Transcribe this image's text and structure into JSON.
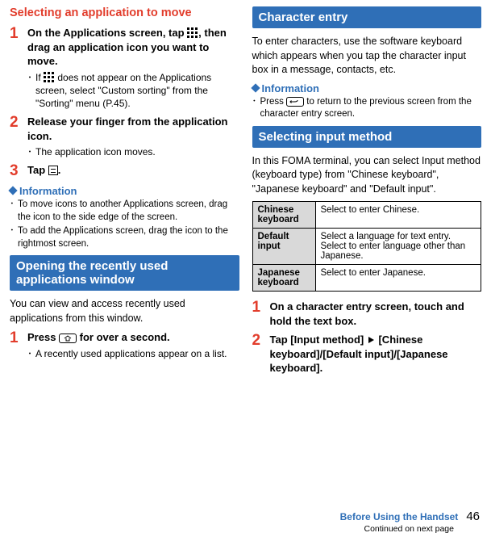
{
  "left": {
    "title": "Selecting an application to move",
    "step1": {
      "head_a": "On the Applications screen, tap ",
      "head_b": ", then drag an application icon you want to move.",
      "bullet1_a": "If ",
      "bullet1_b": " does not appear on the Applications screen, select \"Custom sorting\" from the \"Sorting\" menu (P.45)."
    },
    "step2": {
      "head": "Release your finger from the application icon.",
      "bullet1": "The application icon moves."
    },
    "step3": {
      "head_a": "Tap ",
      "head_b": "."
    },
    "info_title": "Information",
    "info1": "To move icons to another Applications screen, drag the icon to the side edge of the screen.",
    "info2": "To add the Applications screen, drag the icon to the rightmost screen.",
    "heading2": "Opening the recently used applications window",
    "para2": "You can view and access recently used applications from this window.",
    "step_b1": {
      "head_a": "Press ",
      "head_b": " for over a second.",
      "bullet1": "A recently used applications appear on a list."
    }
  },
  "right": {
    "heading1": "Character entry",
    "para1": "To enter characters, use the software keyboard which appears when you tap the character input box in a message, contacts, etc.",
    "info_title": "Information",
    "info1_a": "Press ",
    "info1_b": " to return to the previous screen from the character entry screen.",
    "heading2": "Selecting input method",
    "para2": "In this FOMA terminal, you can select Input method (keyboard type) from \"Chinese keyboard\", \"Japanese keyboard\" and \"Default input\".",
    "table": {
      "r1_label": "Chinese keyboard",
      "r1_val": "Select to enter Chinese.",
      "r2_label": "Default input",
      "r2_val": "Select a language for text entry. Select to enter language other than Japanese.",
      "r3_label": "Japanese keyboard",
      "r3_val": "Select to enter Japanese."
    },
    "step1": {
      "head": "On a character entry screen, touch and hold the text box."
    },
    "step2": {
      "head_a": "Tap [Input method] ",
      "head_b": " [Chinese keyboard]/[Default input]/[Japanese keyboard]."
    }
  },
  "footer": {
    "before": "Before Using the Handset",
    "page": "46",
    "continued": "Continued on next page"
  }
}
